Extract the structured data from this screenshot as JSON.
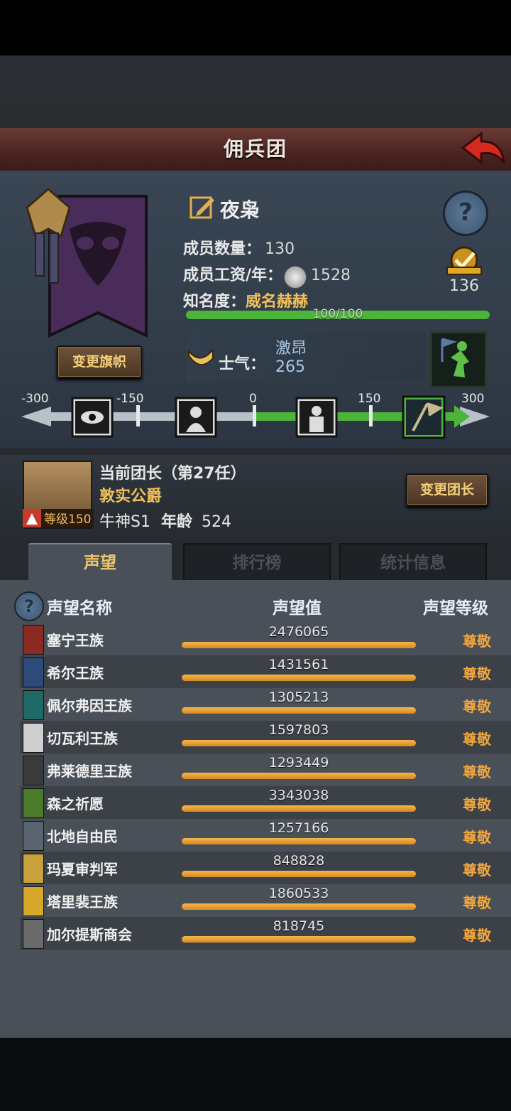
{
  "header": {
    "title": "佣兵团"
  },
  "guild": {
    "name": "夜枭",
    "members_label": "成员数量：",
    "members_value": "130",
    "wage_label": "成员工资/年：",
    "wage_value": "1528",
    "fame_label": "知名度：",
    "fame_value": "威名赫赫",
    "fame_progress_text": "100/100",
    "fame_progress": 1.0,
    "badge_value": "136",
    "change_banner_label": "变更旗帜",
    "morale_label": "士气：",
    "morale_state": "激昂",
    "morale_value": "265",
    "morale_scale_ticks": [
      "-300",
      "-150",
      "0",
      "150",
      "300"
    ]
  },
  "leader": {
    "title_line": "当前团长（第27任）",
    "name": "敦实公爵",
    "level_label": "等级150",
    "zodiac": "牛神S1",
    "age_label": "年龄",
    "age_value": "524",
    "change_leader_label": "变更团长"
  },
  "tabs": [
    {
      "label": "声望",
      "active": true
    },
    {
      "label": "排行榜",
      "active": false
    },
    {
      "label": "统计信息",
      "active": false
    }
  ],
  "reputation": {
    "headers": {
      "name": "声望名称",
      "value": "声望值",
      "level": "声望等级"
    },
    "rows": [
      {
        "name": "塞宁王族",
        "value": "2476065",
        "level": "尊敬",
        "color": "#8a2a20"
      },
      {
        "name": "希尔王族",
        "value": "1431561",
        "level": "尊敬",
        "color": "#2c4a7a"
      },
      {
        "name": "佩尔弗因王族",
        "value": "1305213",
        "level": "尊敬",
        "color": "#1e6a66"
      },
      {
        "name": "切瓦利王族",
        "value": "1597803",
        "level": "尊敬",
        "color": "#cfcfcf"
      },
      {
        "name": "弗莱德里王族",
        "value": "1293449",
        "level": "尊敬",
        "color": "#3a3a3a"
      },
      {
        "name": "森之祈愿",
        "value": "3343038",
        "level": "尊敬",
        "color": "#4a7a2a"
      },
      {
        "name": "北地自由民",
        "value": "1257166",
        "level": "尊敬",
        "color": "#5a6470"
      },
      {
        "name": "玛夏审判军",
        "value": "848828",
        "level": "尊敬",
        "color": "#c8a23a"
      },
      {
        "name": "塔里裴王族",
        "value": "1860533",
        "level": "尊敬",
        "color": "#d8a82a"
      },
      {
        "name": "加尔提斯商会",
        "value": "818745",
        "level": "尊敬",
        "color": "#6a6a6a"
      }
    ]
  }
}
